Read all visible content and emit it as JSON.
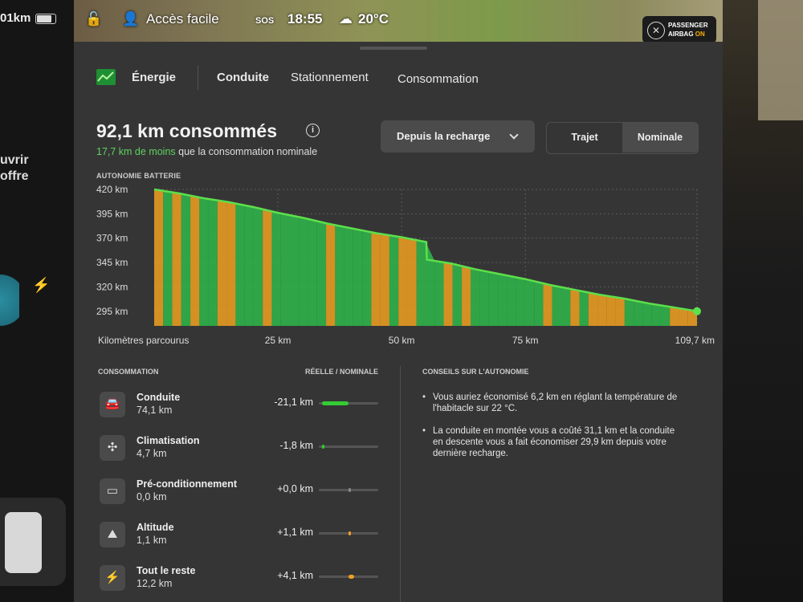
{
  "left": {
    "range": "01km",
    "text_line1": "uvrir",
    "text_line2": "offre"
  },
  "status_bar": {
    "location": "Accès facile",
    "sos": "SOS",
    "time": "18:55",
    "temperature": "20°C",
    "airbag_line1": "PASSENGER",
    "airbag_line2_prefix": "AIRBAG ",
    "airbag_state": "ON"
  },
  "tabs": {
    "energie": "Énergie",
    "conduite": "Conduite",
    "stationnement": "Stationnement",
    "consommation": "Consommation"
  },
  "summary": {
    "headline": "92,1 km consommés",
    "info": "i",
    "saved_highlight": "17,7 km de moins",
    "saved_rest": " que la consommation nominale"
  },
  "controls": {
    "dropdown_label": "Depuis la recharge",
    "segment_trajet": "Trajet",
    "segment_nominale": "Nominale"
  },
  "chart_data": {
    "type": "area",
    "title": "AUTONOMIE BATTERIE",
    "xlabel": "Kilomètres parcourus",
    "x_ticks": [
      "25 km",
      "50 km",
      "75 km",
      "109,7 km"
    ],
    "x_tick_values": [
      25,
      50,
      75,
      109.7
    ],
    "y_ticks": [
      "420 km",
      "395 km",
      "370 km",
      "345 km",
      "320 km",
      "295 km"
    ],
    "y_tick_values": [
      420,
      395,
      370,
      345,
      320,
      295
    ],
    "xlim": [
      0,
      109.7
    ],
    "ylim": [
      280,
      420
    ],
    "series": [
      {
        "x": [
          0,
          5,
          10,
          15,
          20,
          25,
          30,
          35,
          40,
          45,
          50,
          55,
          55.1,
          60,
          65,
          70,
          75,
          80,
          85,
          90,
          95,
          100,
          105,
          109.7
        ],
        "values": [
          420,
          416,
          411,
          407,
          402,
          396,
          391,
          385,
          380,
          375,
          371,
          366,
          348,
          344,
          338,
          333,
          328,
          322,
          317,
          312,
          308,
          303,
          299,
          295
        ]
      }
    ],
    "colors": {
      "efficient": "#2eb84a",
      "consuming": "#f0a020",
      "line": "#5de04a"
    },
    "grid": true
  },
  "consumption": {
    "title": "CONSOMMATION",
    "column_label": "RÉELLE / NOMINALE",
    "rows": [
      {
        "icon": "car-icon",
        "name": "Conduite",
        "value": "74,1 km",
        "delta": "-21,1 km",
        "bar_fraction": -0.45,
        "color": "#33cc33"
      },
      {
        "icon": "fan-icon",
        "name": "Climatisation",
        "value": "4,7 km",
        "delta": "-1,8 km",
        "bar_fraction": -0.04,
        "color": "#33cc33"
      },
      {
        "icon": "battery-icon",
        "name": "Pré-conditionnement",
        "value": "0,0 km",
        "delta": "+0,0 km",
        "bar_fraction": 0,
        "color": "#888888"
      },
      {
        "icon": "mountain-icon",
        "name": "Altitude",
        "value": "1,1 km",
        "delta": "+1,1 km",
        "bar_fraction": 0.02,
        "color": "#f0a020"
      },
      {
        "icon": "bolt-icon",
        "name": "Tout le reste",
        "value": "12,2 km",
        "delta": "+4,1 km",
        "bar_fraction": 0.1,
        "color": "#f0a020"
      }
    ]
  },
  "tips": {
    "title": "CONSEILS SUR L'AUTONOMIE",
    "items": [
      "Vous auriez économisé 6,2 km en réglant la température de l'habitacle sur 22 °C.",
      "La conduite en montée vous a coûté 31,1 km et la conduite en descente vous a fait économiser 29,9 km depuis votre dernière recharge."
    ]
  }
}
